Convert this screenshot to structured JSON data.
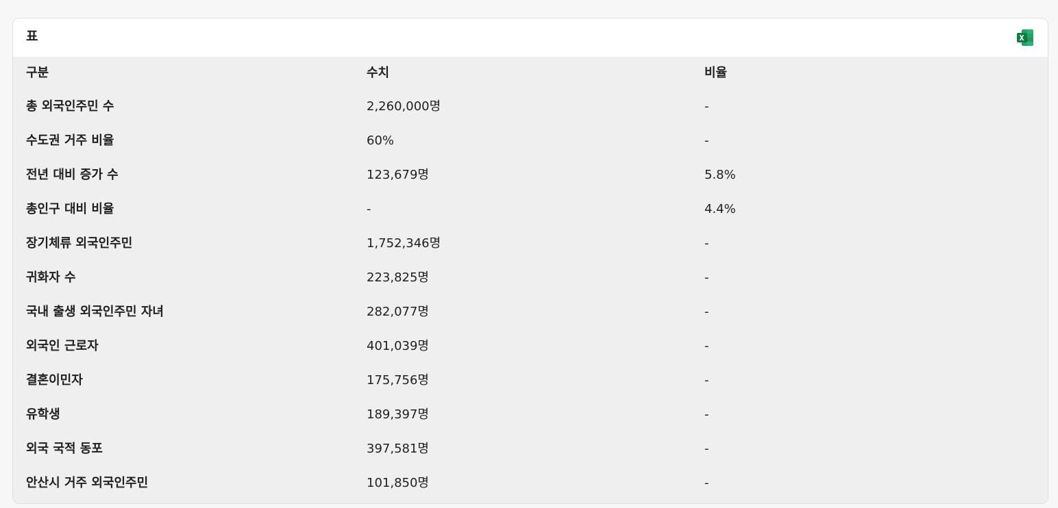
{
  "panel": {
    "title": "표",
    "export_icon": "excel-icon"
  },
  "table": {
    "headers": [
      "구분",
      "수치",
      "비율"
    ],
    "rows": [
      [
        "총 외국인주민 수",
        "2,260,000명",
        "-"
      ],
      [
        "수도권 거주 비율",
        "60%",
        "-"
      ],
      [
        "전년 대비 증가 수",
        "123,679명",
        "5.8%"
      ],
      [
        "총인구 대비 비율",
        "-",
        "4.4%"
      ],
      [
        "장기체류 외국인주민",
        "1,752,346명",
        "-"
      ],
      [
        "귀화자 수",
        "223,825명",
        "-"
      ],
      [
        "국내 출생 외국인주민 자녀",
        "282,077명",
        "-"
      ],
      [
        "외국인 근로자",
        "401,039명",
        "-"
      ],
      [
        "결혼이민자",
        "175,756명",
        "-"
      ],
      [
        "유학생",
        "189,397명",
        "-"
      ],
      [
        "외국 국적 동포",
        "397,581명",
        "-"
      ],
      [
        "안산시 거주 외국인주민",
        "101,850명",
        "-"
      ]
    ]
  },
  "colors": {
    "excel_green": "#1d7044",
    "excel_light": "#21a366"
  }
}
